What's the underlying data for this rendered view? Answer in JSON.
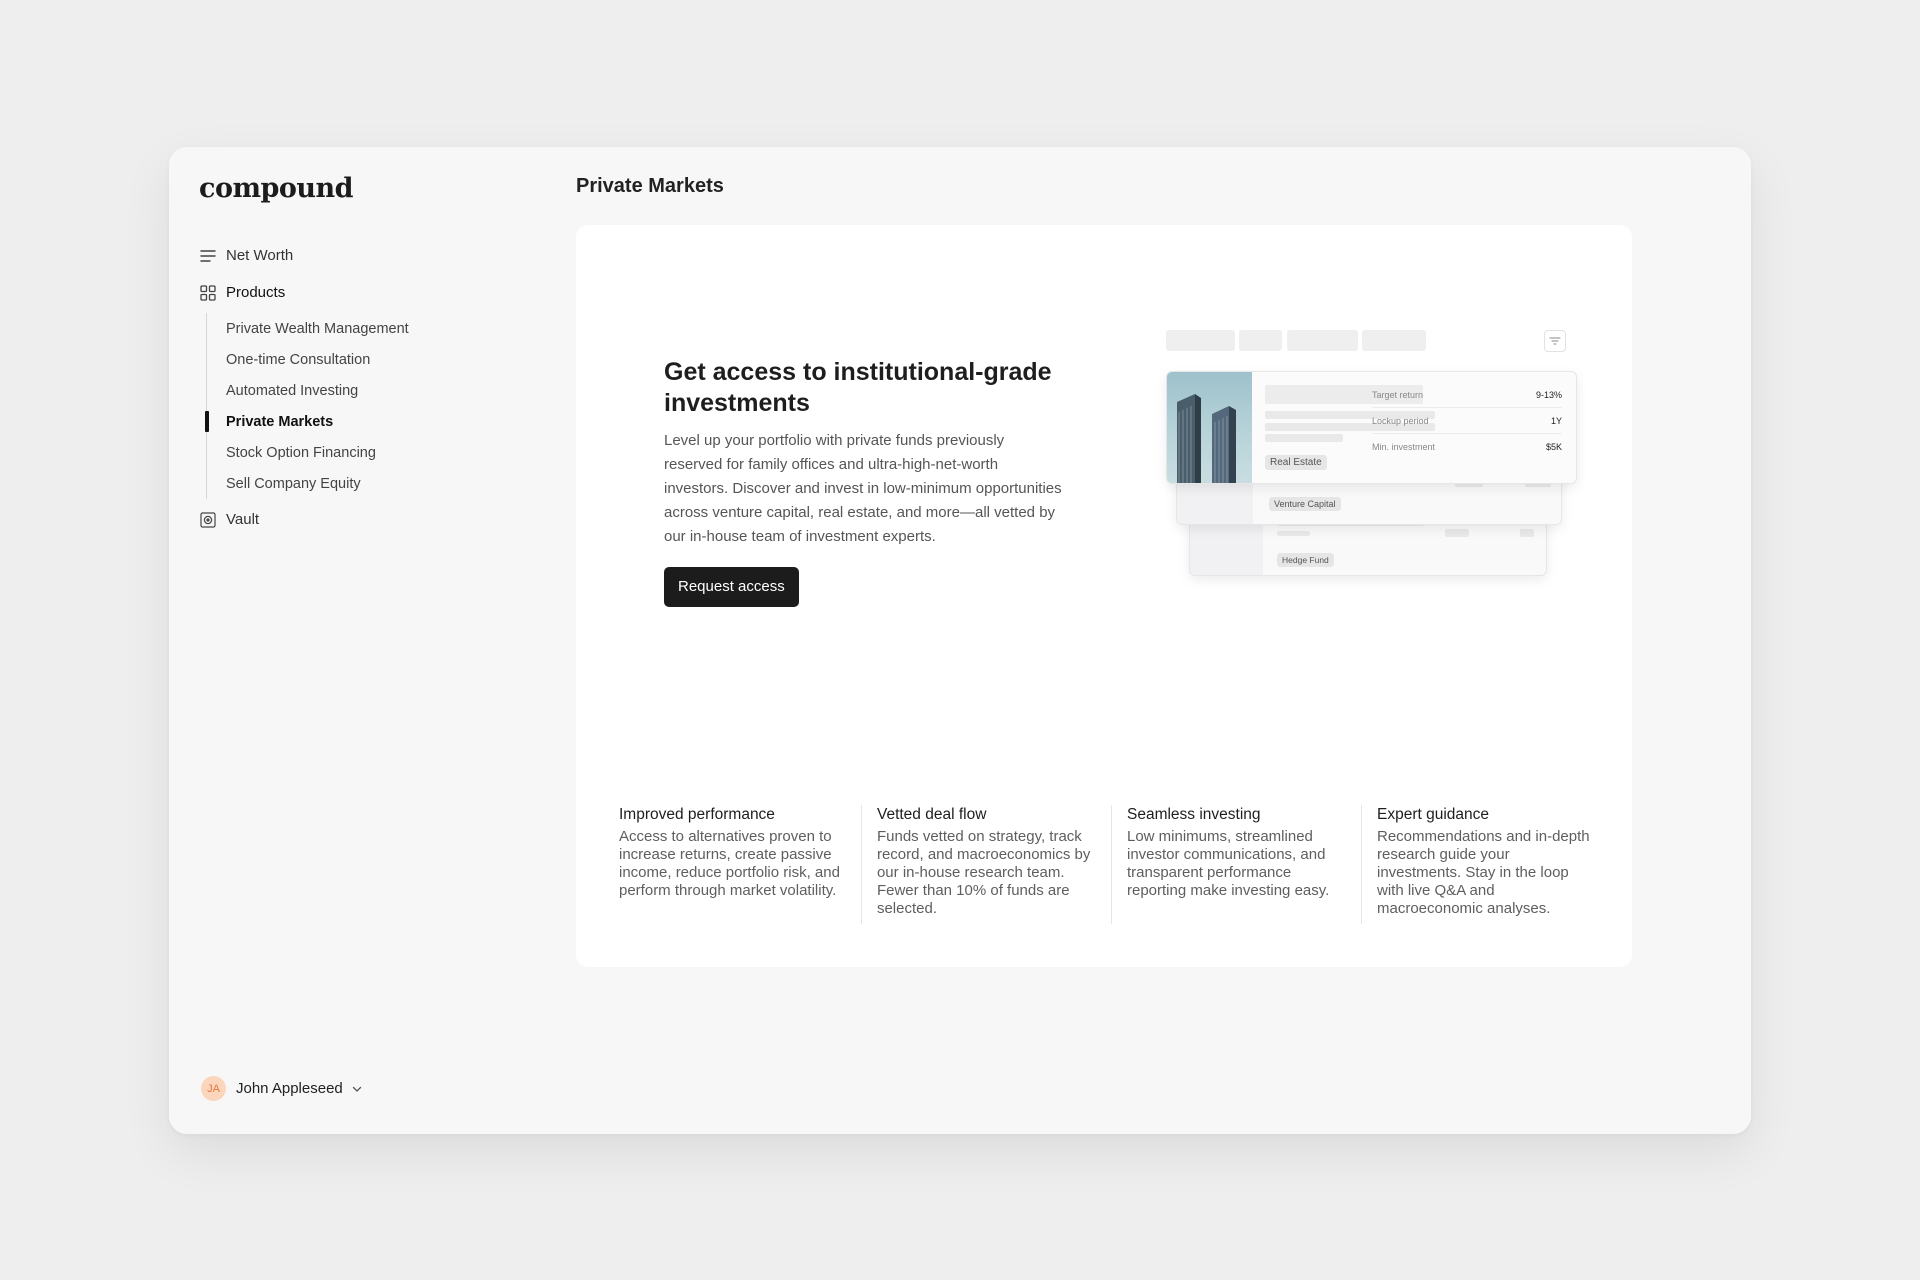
{
  "sidebar": {
    "logo": "compound",
    "items": [
      {
        "label": "Net Worth",
        "icon": "list-icon"
      },
      {
        "label": "Products",
        "icon": "grid-icon"
      },
      {
        "label": "Vault",
        "icon": "vault-icon"
      }
    ],
    "products": [
      {
        "label": "Private Wealth Management"
      },
      {
        "label": "One-time Consultation"
      },
      {
        "label": "Automated Investing"
      },
      {
        "label": "Private Markets",
        "active": true
      },
      {
        "label": "Stock Option Financing"
      },
      {
        "label": "Sell Company Equity"
      }
    ],
    "user": {
      "initials": "JA",
      "name": "John Appleseed"
    }
  },
  "main": {
    "title": "Private Markets",
    "hero": {
      "heading": "Get access to institutional-grade investments",
      "body": "Level up your portfolio with private funds previously reserved for family offices and ultra-high-net-worth investors. Discover and invest in low-minimum opportunities across venture capital, real estate, and more—all vetted by our in-house team of investment experts.",
      "cta": "Request access"
    },
    "illustration": {
      "cards": [
        {
          "tag": "Real Estate",
          "stats": [
            {
              "label": "Target return",
              "value": "9-13%"
            },
            {
              "label": "Lockup period",
              "value": "1Y"
            },
            {
              "label": "Min. investment",
              "value": "$5K"
            }
          ]
        },
        {
          "tag": "Venture Capital"
        },
        {
          "tag": "Hedge Fund"
        }
      ]
    },
    "features": [
      {
        "title": "Improved performance",
        "body": "Access to alternatives proven to increase returns, create passive income, reduce portfolio risk, and perform through market volatility."
      },
      {
        "title": "Vetted deal flow",
        "body": "Funds vetted on strategy, track record, and macroeconomics by our in-house research team. Fewer than 10% of funds are selected."
      },
      {
        "title": "Seamless investing",
        "body": "Low minimums, streamlined investor communications, and transparent performance reporting make investing easy."
      },
      {
        "title": "Expert guidance",
        "body": "Recommendations and in-depth research guide your investments. Stay in the loop with live Q&A and macroeconomic analyses."
      }
    ]
  },
  "colors": {
    "accent": "#1c1c1c",
    "avatar_bg": "#fcd5bd",
    "avatar_text": "#e2793e"
  }
}
